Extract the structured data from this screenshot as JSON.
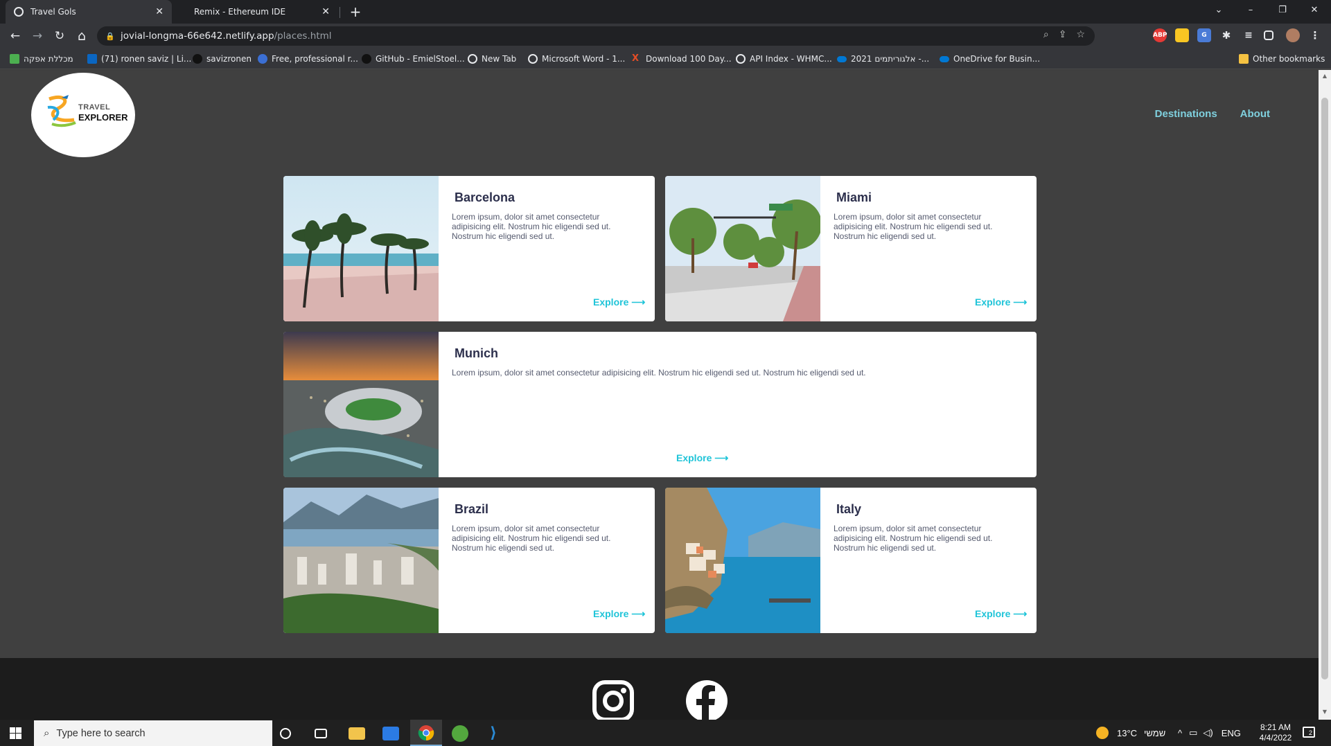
{
  "browser": {
    "tabs": [
      {
        "title": "Travel Gols",
        "active": true
      },
      {
        "title": "Remix - Ethereum IDE",
        "active": false
      }
    ],
    "new_tab_label": "+",
    "window_controls": {
      "chevron": "⌄",
      "minimize": "–",
      "restore": "❐",
      "close": "✕"
    },
    "url_host": "jovial-longma-66e642.netlify.app",
    "url_path": "/places.html",
    "nav": {
      "back": "←",
      "forward": "→",
      "reload": "↻",
      "home": "⌂"
    },
    "bookmarks": [
      {
        "label": "מכללת אפקה",
        "icon": "leaf-icon",
        "color": "#4caf50"
      },
      {
        "label": "(71) ronen saviz | Li...",
        "icon": "linkedin-icon",
        "color": "#0a66c2"
      },
      {
        "label": "savizronen",
        "icon": "github-icon",
        "color": "#24292e"
      },
      {
        "label": "Free, professional r...",
        "icon": "c-icon",
        "color": "#3b6fd4"
      },
      {
        "label": "GitHub - EmielStoel...",
        "icon": "github-icon",
        "color": "#24292e"
      },
      {
        "label": "New Tab",
        "icon": "globe-icon",
        "color": "#e8eaed"
      },
      {
        "label": "Microsoft Word - 1...",
        "icon": "globe-icon",
        "color": "#e8eaed"
      },
      {
        "label": "Download 100 Day...",
        "icon": "x-icon",
        "color": "#e44d26"
      },
      {
        "label": "API Index - WHMC...",
        "icon": "globe-icon",
        "color": "#e8eaed"
      },
      {
        "label": "אלגוריתמים 2021 -...",
        "icon": "cloud-icon",
        "color": "#0078d4"
      },
      {
        "label": "OneDrive for Busin...",
        "icon": "cloud-icon",
        "color": "#0078d4"
      },
      {
        "label": "Other bookmarks",
        "icon": "folder-icon",
        "color": "#f5c242"
      }
    ]
  },
  "site": {
    "logo_line1": "TRAVEL",
    "logo_line2": "EXPLORER",
    "nav": [
      {
        "label": "Destinations"
      },
      {
        "label": "About"
      }
    ],
    "cards": [
      {
        "title": "Barcelona",
        "text": "Lorem ipsum, dolor sit amet consectetur adipisicing elit. Nostrum hic eligendi sed ut. Nostrum hic eligendi sed ut.",
        "link": "Explore ⟶"
      },
      {
        "title": "Miami",
        "text": "Lorem ipsum, dolor sit amet consectetur adipisicing elit. Nostrum hic eligendi sed ut. Nostrum hic eligendi sed ut.",
        "link": "Explore ⟶"
      },
      {
        "title": "Munich",
        "text": "Lorem ipsum, dolor sit amet consectetur adipisicing elit. Nostrum hic eligendi sed ut. Nostrum hic eligendi sed ut.",
        "link": "Explore ⟶"
      },
      {
        "title": "Brazil",
        "text": "Lorem ipsum, dolor sit amet consectetur adipisicing elit. Nostrum hic eligendi sed ut. Nostrum hic eligendi sed ut.",
        "link": "Explore ⟶"
      },
      {
        "title": "Italy",
        "text": "Lorem ipsum, dolor sit amet consectetur adipisicing elit. Nostrum hic eligendi sed ut. Nostrum hic eligendi sed ut.",
        "link": "Explore ⟶"
      }
    ],
    "accent_color": "#1fc4d8",
    "nav_color": "#7fd0de"
  },
  "taskbar": {
    "search_placeholder": "Type here to search",
    "weather": "13°C",
    "weather_label": "שמשי",
    "language": "ENG",
    "time": "8:21 AM",
    "date": "4/4/2022",
    "notification_count": "2"
  }
}
